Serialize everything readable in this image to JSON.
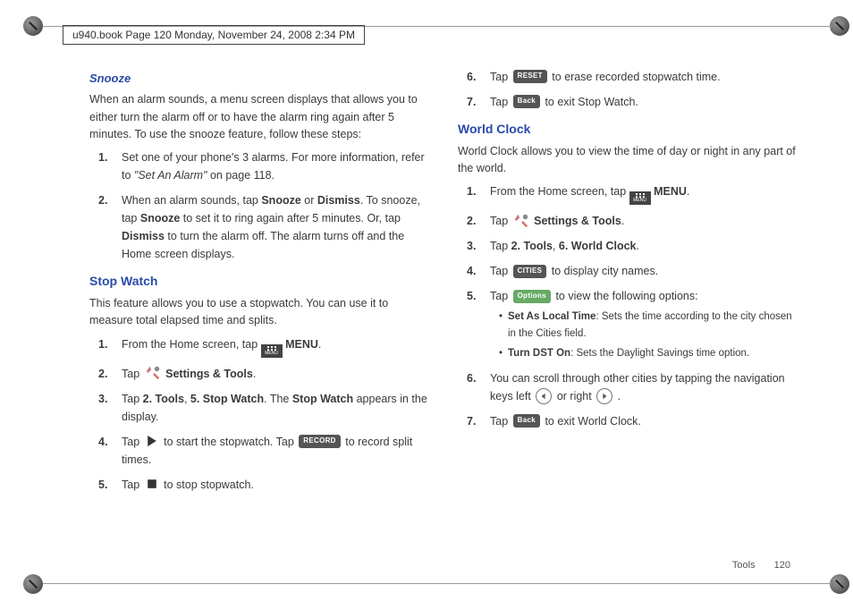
{
  "meta": {
    "pageref": "u940.book  Page 120  Monday, November 24, 2008  2:34 PM",
    "footer_label": "Tools",
    "page_number": "120"
  },
  "snooze": {
    "heading": "Snooze",
    "intro": "When an alarm sounds, a menu screen displays that allows you to either turn the alarm off or to have the alarm ring again after 5 minutes. To use the snooze feature, follow these steps:",
    "steps": {
      "s1a": "Set one of your phone's 3 alarms. For more information, refer to ",
      "s1b_ref": "\"Set An Alarm\"",
      "s1c": "  on page 118.",
      "s2a": "When an alarm sounds, tap ",
      "s2_snooze": "Snooze",
      "s2b": " or ",
      "s2_dismiss": "Dismiss",
      "s2c": ". To snooze, tap ",
      "s2d": " to set it to ring again after 5 minutes. Or, tap ",
      "s2e": " to turn the alarm off. The alarm turns off and the Home screen displays."
    }
  },
  "stopwatch": {
    "heading": "Stop Watch",
    "intro": "This feature allows you to use a stopwatch. You can use it to measure total elapsed time and splits.",
    "steps": {
      "s1a": "From the Home screen, tap ",
      "s1b": " MENU",
      "s2a": "Tap ",
      "s2b": " Settings & Tools",
      "s3a": "Tap ",
      "s3_tools": "2. Tools",
      "s3_comma": ", ",
      "s3_sw": "5. Stop Watch",
      "s3b": ". The ",
      "s3_sw2": "Stop Watch",
      "s3c": " appears in the display.",
      "s4a": "Tap ",
      "s4b": " to start the stopwatch. Tap ",
      "s4c": " to record split times.",
      "s5a": "Tap ",
      "s5b": " to stop stopwatch.",
      "s6a": "Tap ",
      "s6b": " to erase recorded stopwatch time.",
      "s7a": "Tap ",
      "s7b": " to exit Stop Watch."
    },
    "keys": {
      "record": "RECORD",
      "reset": "RESET",
      "back": "Back"
    }
  },
  "worldclock": {
    "heading": "World Clock",
    "intro": "World Clock allows you to view the time of day or night in any part of the world.",
    "steps": {
      "s1a": "From the Home screen, tap ",
      "s1b": " MENU",
      "s2a": "Tap ",
      "s2b": " Settings & Tools",
      "s3a": "Tap ",
      "s3_tools": "2. Tools",
      "s3_comma": ", ",
      "s3_wc": "6. World Clock",
      "s4a": "Tap ",
      "s4b": " to display city names.",
      "s5a": "Tap ",
      "s5b": " to view the following options:",
      "b1_t": "Set As Local Time",
      "b1": ": Sets the time according to the city chosen in the Cities field.",
      "b2_t": "Turn DST On",
      "b2": ": Sets the Daylight Savings time option.",
      "s6": "You can scroll through other cities by tapping the navigation keys left ",
      "s6_or": " or right ",
      "s7a": "Tap ",
      "s7b": " to exit World Clock."
    },
    "keys": {
      "cities": "CITIES",
      "options": "Options",
      "back": "Back"
    }
  }
}
